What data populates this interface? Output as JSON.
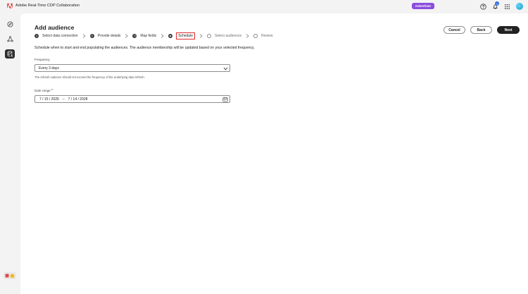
{
  "app": {
    "title": "Adobe Real-Time CDP Collaboration",
    "role_badge": "Advertiser",
    "notification_count": "1"
  },
  "page": {
    "title": "Add audience"
  },
  "steps": [
    {
      "number": "1",
      "label": "Select data connection",
      "state": "done"
    },
    {
      "number": "2",
      "label": "Provide details",
      "state": "done"
    },
    {
      "number": "3",
      "label": "Map fields",
      "state": "done"
    },
    {
      "number": "",
      "label": "Schedule",
      "state": "current"
    },
    {
      "number": "",
      "label": "Select audiences",
      "state": "todo"
    },
    {
      "number": "",
      "label": "Review",
      "state": "todo"
    }
  ],
  "actions": {
    "cancel": "Cancel",
    "back": "Back",
    "next": "Next"
  },
  "intro": "Schedule when to start and end populating the audiences. The audience membership will be updated based on your selected frequency.",
  "frequency": {
    "label": "Frequency",
    "value": "Every 3 days",
    "help": "The refresh cadence should not exceed the frequency of the underlying data refresh."
  },
  "date_range": {
    "label": "Date range",
    "required_mark": "*",
    "start": "7 / 15 / 2026",
    "separator": "–",
    "end": "7 / 14 / 2028"
  },
  "colors": {
    "accent_badge": "#8b4ddc",
    "primary_button": "#222222",
    "current_step_outline": "#e02a2a",
    "notification": "#2f6fe0"
  },
  "icons": [
    "adobe-logo-icon",
    "help-icon",
    "bell-icon",
    "apps-grid-icon",
    "compass-icon",
    "connections-icon",
    "audience-database-icon",
    "chevron-down-icon",
    "calendar-icon",
    "double-chevron-right-icon"
  ]
}
